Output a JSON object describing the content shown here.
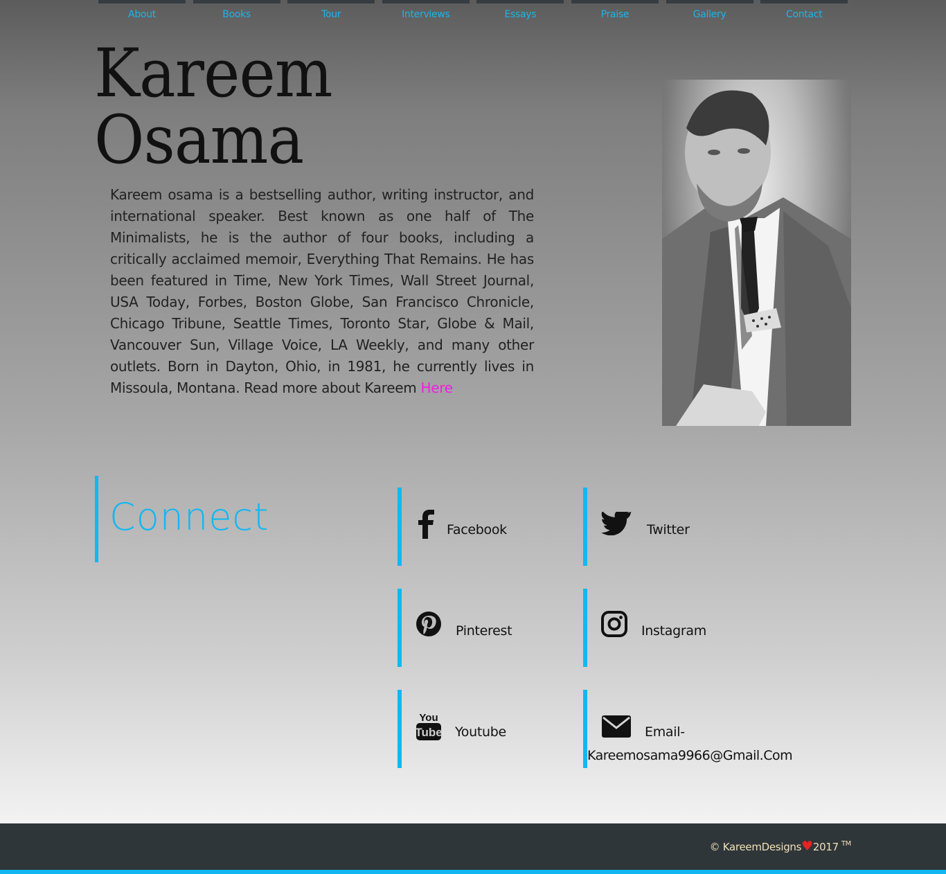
{
  "nav": [
    "About",
    "Books",
    "Tour",
    "Interviews",
    "Essays",
    "Praise",
    "Gallery",
    "Contact"
  ],
  "hero": {
    "name_line1": "Kareem",
    "name_line2": "Osama",
    "bio": "Kareem osama is a bestselling author, writing instructor, and international speaker. Best known as one half of The Minimalists, he is the author of four books, including a critically acclaimed memoir, Everything That Remains. He has been featured in Time, New York Times, Wall Street Journal, USA Today, Forbes, Boston Globe, San Francisco Chronicle, Chicago Tribune, Seattle Times, Toronto Star, Globe & Mail, Vancouver Sun, Village Voice, LA Weekly, and many other outlets. Born in Dayton, Ohio, in 1981, he currently lives in Missoula, Montana. Read more about Kareem ",
    "bio_link": "Here"
  },
  "connect": {
    "title": "Connect",
    "items": {
      "facebook": "Facebook",
      "twitter": "Twitter",
      "pinterest": "Pinterest",
      "instagram": "Instagram",
      "youtube": "Youtube",
      "email_label": "Email-",
      "email_address": "Kareemosama9966@Gmail.Com"
    },
    "icons": [
      "facebook-icon",
      "twitter-icon",
      "pinterest-icon",
      "instagram-icon",
      "youtube-icon",
      "envelope-icon"
    ]
  },
  "footer": {
    "copyright": "© KareemDesigns",
    "year": "2017",
    "tm": "TM"
  },
  "colors": {
    "accent": "#12b7f2",
    "link": "#f31de0",
    "footer_bg": "#2f363a",
    "heart": "#e52323"
  }
}
